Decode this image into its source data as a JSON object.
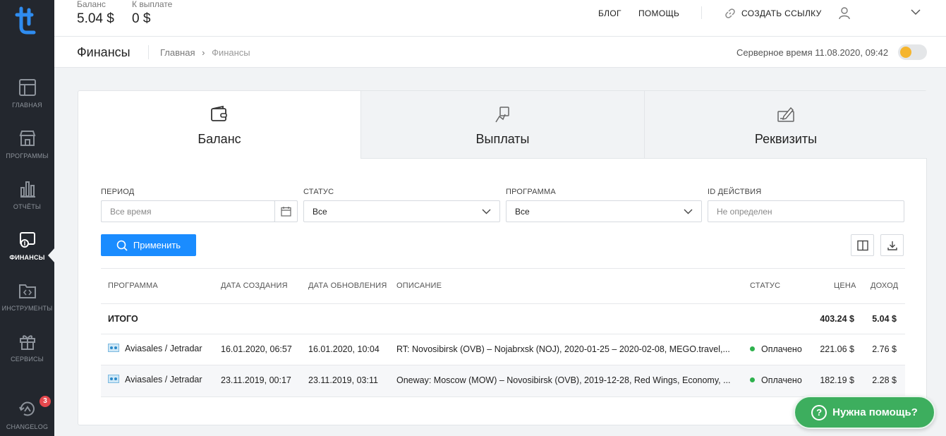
{
  "sidebar": {
    "items": [
      {
        "label": "ГЛАВНАЯ",
        "icon": "dashboard-icon"
      },
      {
        "label": "ПРОГРАММЫ",
        "icon": "store-icon"
      },
      {
        "label": "ОТЧЁТЫ",
        "icon": "bar-chart-icon"
      },
      {
        "label": "ФИНАНСЫ",
        "icon": "finance-icon",
        "active": true
      },
      {
        "label": "ИНСТРУМЕНТЫ",
        "icon": "code-folder-icon"
      },
      {
        "label": "СЕРВИСЫ",
        "icon": "gift-icon"
      },
      {
        "label": "CHANGELOG",
        "icon": "changelog-icon"
      }
    ],
    "changelog_badge": "3"
  },
  "topbar": {
    "balance_label": "Баланс",
    "balance_value": "5.04 $",
    "payout_label": "К выплате",
    "payout_value": "0 $",
    "blog": "БЛОГ",
    "help": "ПОМОЩЬ",
    "create_link": "СОЗДАТЬ ССЫЛКУ"
  },
  "pagehead": {
    "title": "Финансы",
    "crumb_home": "Главная",
    "crumb_sep": "›",
    "crumb_current": "Финансы",
    "server_time": "Серверное время 11.08.2020, 09:42"
  },
  "tabs": [
    {
      "label": "Баланс",
      "icon": "wallet-icon",
      "active": true
    },
    {
      "label": "Выплаты",
      "icon": "payout-hand-icon"
    },
    {
      "label": "Реквизиты",
      "icon": "signature-icon"
    }
  ],
  "filters": {
    "period_label": "ПЕРИОД",
    "period_placeholder": "Все время",
    "status_label": "СТАТУС",
    "status_value": "Все",
    "program_label": "ПРОГРАММА",
    "program_value": "Все",
    "action_id_label": "ID ДЕЙСТВИЯ",
    "action_id_placeholder": "Не определен",
    "apply": "Применить"
  },
  "table": {
    "headers": {
      "program": "ПРОГРАММА",
      "created": "ДАТА СОЗДАНИЯ",
      "updated": "ДАТА ОБНОВЛЕНИЯ",
      "description": "ОПИСАНИЕ",
      "status": "СТАТУС",
      "price": "ЦЕНА",
      "income": "ДОХОД"
    },
    "total": {
      "label": "ИТОГО",
      "price": "403.24 $",
      "income": "5.04 $"
    },
    "rows": [
      {
        "program": "Aviasales / Jetradar",
        "created": "16.01.2020, 06:57",
        "updated": "16.01.2020, 10:04",
        "description": "RT: Novosibirsk (OVB) – Nojabrxsk (NOJ), 2020-01-25 – 2020-02-08, MEGO.travel,...",
        "status": "Оплачено",
        "price": "221.06 $",
        "income": "2.76 $"
      },
      {
        "program": "Aviasales / Jetradar",
        "created": "23.11.2019, 00:17",
        "updated": "23.11.2019, 03:11",
        "description": "Oneway: Moscow (MOW) – Novosibirsk (OVB), 2019-12-28, Red Wings, Economy, ...",
        "status": "Оплачено",
        "price": "182.19 $",
        "income": "2.28 $"
      }
    ]
  },
  "help_button": "Нужна помощь?",
  "colors": {
    "sidebar": "#23272e",
    "primary": "#1a8cff",
    "help": "#3dae5e",
    "paid": "#2eb14d",
    "toggle_knob": "#f5b52e"
  }
}
